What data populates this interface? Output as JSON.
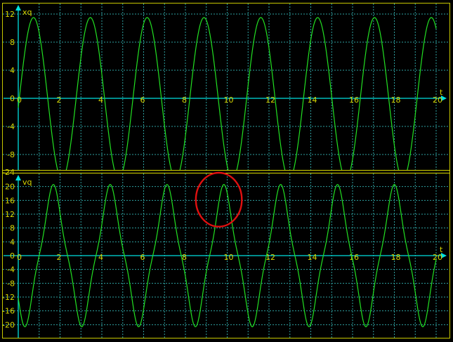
{
  "colors": {
    "background": "#000000",
    "frame": "#c8c800",
    "grid": "#2ea0a0",
    "axis": "#00e0e0",
    "trace": "#22e022",
    "labels": "#d8d800",
    "highlight": "#e01010"
  },
  "chart_data": [
    {
      "type": "line",
      "ylabel": "xq",
      "xlabel": "t",
      "xlim": [
        0,
        20
      ],
      "ylim": [
        -12,
        12
      ],
      "grid": true,
      "x_ticks": [
        0,
        2,
        4,
        6,
        8,
        10,
        12,
        14,
        16,
        18,
        20
      ],
      "x_tick_labels": [
        "0",
        "2",
        "4",
        "6",
        "8",
        "10",
        "12",
        "14",
        "16",
        "18",
        "20"
      ],
      "y_ticks": [
        12,
        8,
        4,
        0,
        -4,
        -8
      ],
      "y_tick_labels": [
        "12",
        "8",
        "4",
        "0",
        "-4",
        "-8"
      ],
      "series": [
        {
          "model": "sine",
          "amplitude": 11.5,
          "period": 2.72,
          "phase_zero": 0.05,
          "samples": 700,
          "t_range": [
            0,
            20
          ]
        }
      ]
    },
    {
      "type": "line",
      "ylabel": "vq",
      "xlabel": "t",
      "xlim": [
        0,
        20
      ],
      "ylim": [
        -24,
        24
      ],
      "grid": true,
      "x_ticks": [
        0,
        2,
        4,
        6,
        8,
        10,
        12,
        14,
        16,
        18,
        20
      ],
      "x_tick_labels": [
        "0",
        "2",
        "4",
        "6",
        "8",
        "10",
        "12",
        "14",
        "16",
        "18",
        "20"
      ],
      "y_ticks": [
        24,
        20,
        16,
        12,
        8,
        4,
        0,
        -4,
        -8,
        -12,
        -16,
        -20,
        -24
      ],
      "y_tick_labels": [
        "-24",
        "20",
        "16",
        "12",
        "8",
        "4",
        "0",
        "-4",
        "-8",
        "-12",
        "-16",
        "-20",
        "-24"
      ],
      "series": [
        {
          "model": "sine-with-third-harmonic",
          "amplitude": 18.4,
          "third_harmonic": -2.2,
          "period": 2.72,
          "phase_zero": 1.0,
          "samples": 700,
          "t_range": [
            0,
            20
          ]
        }
      ],
      "annotations": [
        {
          "type": "circle",
          "x": 9.6,
          "y": 16.2,
          "rx": 1.1,
          "ry": 7.8
        }
      ]
    }
  ]
}
